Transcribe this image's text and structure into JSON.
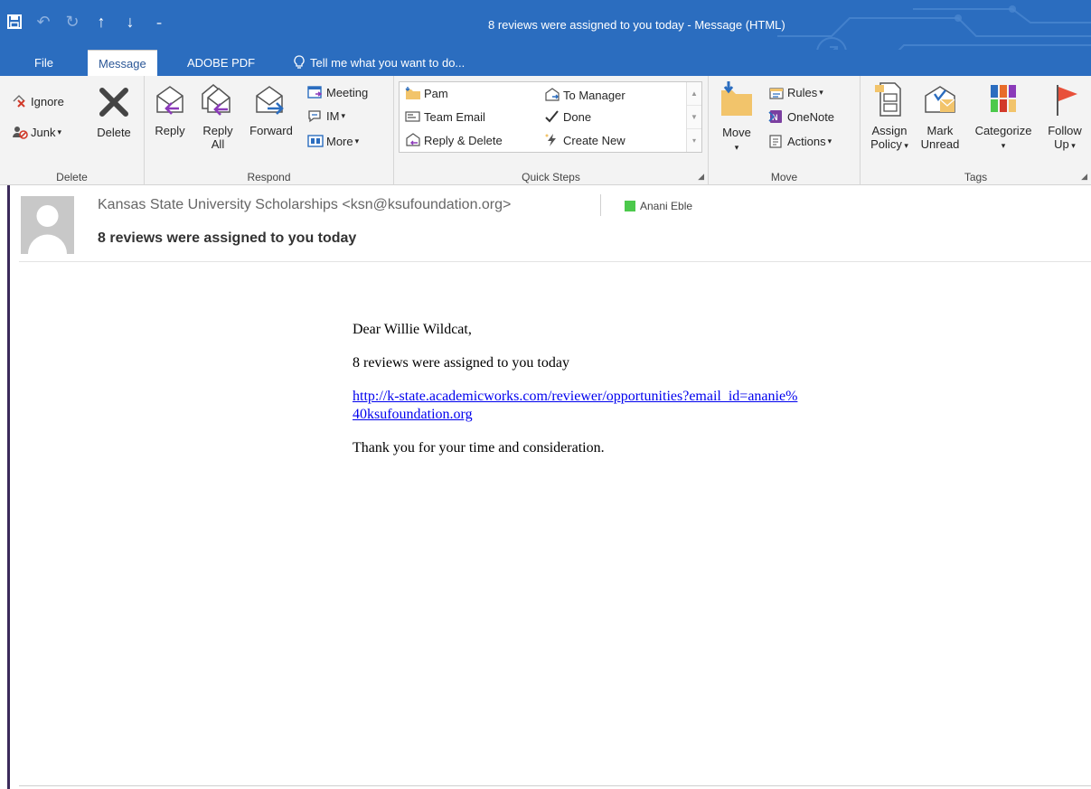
{
  "window": {
    "title": "8 reviews were assigned to you today - Message (HTML)"
  },
  "quick_access": [
    "save-icon",
    "undo-icon",
    "redo-icon",
    "up-arrow-icon",
    "down-arrow-icon",
    "customize-icon"
  ],
  "tabs": {
    "file": "File",
    "message": "Message",
    "adobe_pdf": "ADOBE PDF",
    "tell_me": "Tell me what you want to do..."
  },
  "ribbon": {
    "delete_group": {
      "label": "Delete",
      "ignore": "Ignore",
      "junk": "Junk",
      "delete": "Delete"
    },
    "respond_group": {
      "label": "Respond",
      "reply": "Reply",
      "reply_all_1": "Reply",
      "reply_all_2": "All",
      "forward": "Forward",
      "meeting": "Meeting",
      "im": "IM",
      "more": "More"
    },
    "quick_steps_group": {
      "label": "Quick Steps",
      "items": [
        "Pam",
        "To Manager",
        "Team Email",
        "Done",
        "Reply & Delete",
        "Create New"
      ]
    },
    "move_group": {
      "label": "Move",
      "move": "Move",
      "rules": "Rules",
      "onenote": "OneNote",
      "actions": "Actions"
    },
    "tags_group": {
      "label": "Tags",
      "assign_1": "Assign",
      "assign_2": "Policy",
      "mark_1": "Mark",
      "mark_2": "Unread",
      "categorize": "Categorize",
      "follow_1": "Follow",
      "follow_2": "Up"
    }
  },
  "message": {
    "sender": "Kansas State University Scholarships <ksn@ksufoundation.org>",
    "category": "Anani Eble",
    "category_color": "#4cc94c",
    "subject": "8 reviews were assigned to you today",
    "greeting": "Dear Willie Wildcat,",
    "line1": "8 reviews were assigned to you today",
    "link_line1": "http://k-state.academicworks.com/reviewer/opportunities?email_id=ananie%",
    "link_line2": "40ksufoundation.org",
    "closing": "Thank you for your time and consideration."
  },
  "colors": {
    "accent": "#2b6dbf",
    "link": "#0000ee"
  }
}
